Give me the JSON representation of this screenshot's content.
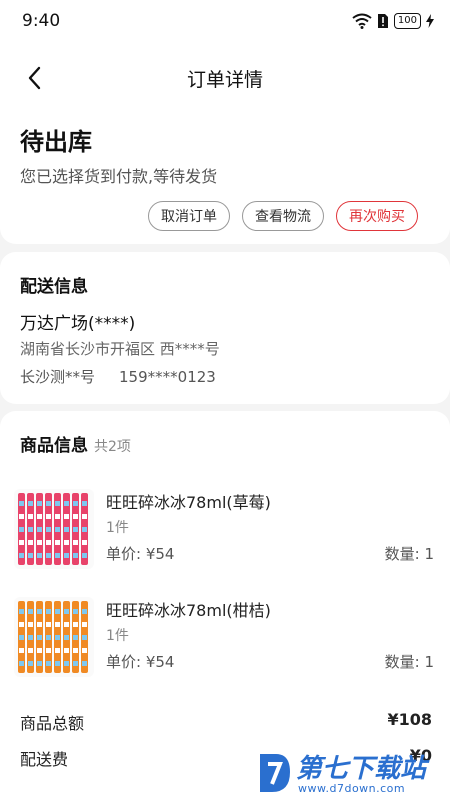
{
  "statusbar": {
    "time": "9:40",
    "battery": "100"
  },
  "nav": {
    "title": "订单详情"
  },
  "order_status": {
    "title": "待出库",
    "description": "您已选择货到付款,等待发货",
    "buttons": {
      "cancel": "取消订单",
      "logistics": "查看物流",
      "rebuy": "再次购买"
    }
  },
  "delivery": {
    "section_title": "配送信息",
    "name": "万达广场(****)",
    "address": "湖南省长沙市开福区 西****号",
    "contact_name": "长沙测**号",
    "phone": "159****0123"
  },
  "goods": {
    "section_title": "商品信息",
    "count_label": "共2项",
    "items": [
      {
        "name": "旺旺碎冰冰78ml(草莓)",
        "qty": "1件",
        "price": "单价: ¥54",
        "quantity": "数量: 1",
        "color": "#e8436a"
      },
      {
        "name": "旺旺碎冰冰78ml(柑桔)",
        "qty": "1件",
        "price": "单价: ¥54",
        "quantity": "数量: 1",
        "color": "#f08a24"
      }
    ]
  },
  "summary": {
    "total_label": "商品总额",
    "total_value": "¥108",
    "shipping_label": "配送费",
    "shipping_value": "¥0"
  },
  "watermark": {
    "brand": "第七下载站",
    "url": "www.d7down.com"
  },
  "colors": {
    "accent": "#e0353a",
    "watermark": "#2a6fcf"
  }
}
